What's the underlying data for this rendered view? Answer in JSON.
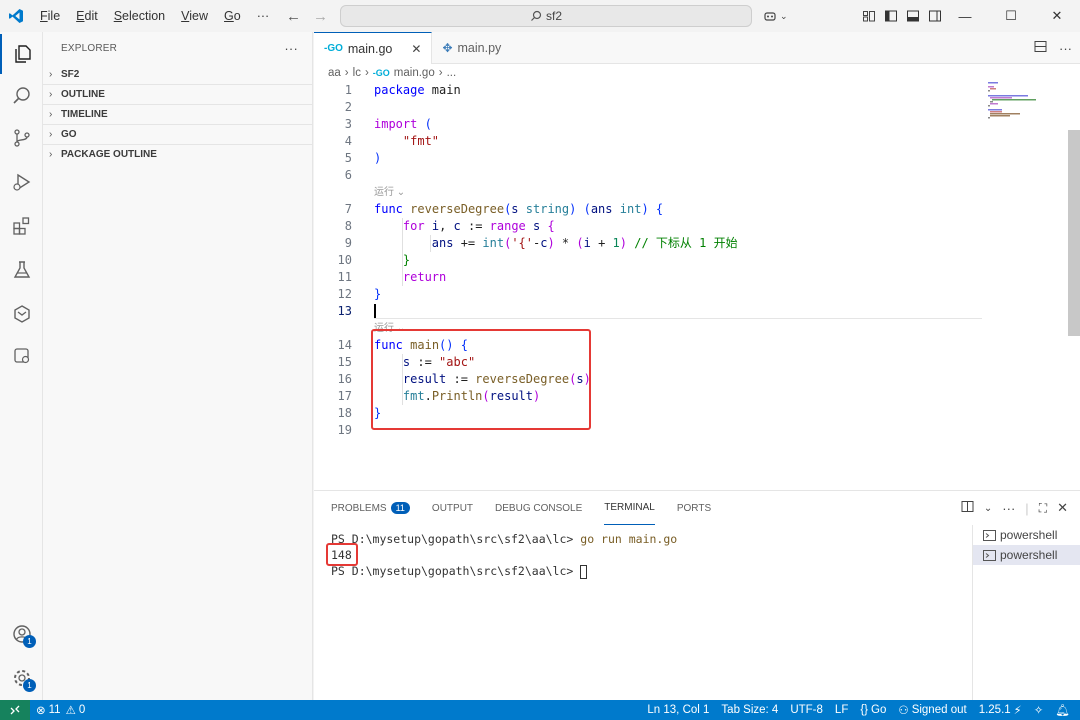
{
  "menu": {
    "file": {
      "u": "F",
      "rest": "ile"
    },
    "edit": {
      "u": "E",
      "rest": "dit"
    },
    "selection": {
      "u": "S",
      "rest": "election"
    },
    "view": {
      "u": "V",
      "rest": "iew"
    },
    "go": {
      "u": "G",
      "rest": "o"
    },
    "more": "···"
  },
  "search": {
    "text": "sf2"
  },
  "explorer": {
    "title": "EXPLORER",
    "more": "···",
    "sections": [
      "SF2",
      "OUTLINE",
      "TIMELINE",
      "GO",
      "PACKAGE OUTLINE"
    ]
  },
  "tabs": [
    {
      "label": "main.go",
      "close": "✕"
    },
    {
      "label": "main.py"
    }
  ],
  "breadcrumb": {
    "folder1": "aa",
    "folder2": "lc",
    "file": "main.go",
    "more": "..."
  },
  "codelens": "运行",
  "code": {
    "lines": [
      {
        "n": "1",
        "parts": [
          [
            "kw",
            "package"
          ],
          [
            "",
            " main"
          ]
        ]
      },
      {
        "n": "2",
        "parts": []
      },
      {
        "n": "3",
        "parts": [
          [
            "kw2",
            "import"
          ],
          [
            "",
            " "
          ],
          [
            "par",
            "("
          ]
        ]
      },
      {
        "n": "4",
        "parts": [
          [
            "",
            "    "
          ],
          [
            "str",
            "\"fmt\""
          ]
        ]
      },
      {
        "n": "5",
        "parts": [
          [
            "par",
            ")"
          ]
        ]
      },
      {
        "n": "6",
        "parts": []
      },
      {
        "n": "7",
        "parts": [
          [
            "kw",
            "func"
          ],
          [
            "",
            " "
          ],
          [
            "fn",
            "reverseDegree"
          ],
          [
            "par",
            "("
          ],
          [
            "var",
            "s"
          ],
          [
            "",
            " "
          ],
          [
            "ty",
            "string"
          ],
          [
            "par",
            ")"
          ],
          [
            "",
            " "
          ],
          [
            "par",
            "("
          ],
          [
            "var",
            "ans"
          ],
          [
            "",
            " "
          ],
          [
            "ty",
            "int"
          ],
          [
            "par",
            ")"
          ],
          [
            "",
            " "
          ],
          [
            "par",
            "{"
          ]
        ]
      },
      {
        "n": "8",
        "parts": [
          [
            "",
            "    "
          ],
          [
            "kw2",
            "for"
          ],
          [
            "",
            " "
          ],
          [
            "var",
            "i"
          ],
          [
            "",
            ", "
          ],
          [
            "var",
            "c"
          ],
          [
            "",
            " := "
          ],
          [
            "kw2",
            "range"
          ],
          [
            "",
            " "
          ],
          [
            "var",
            "s"
          ],
          [
            "",
            " "
          ],
          [
            "kw2",
            "{"
          ]
        ]
      },
      {
        "n": "9",
        "parts": [
          [
            "",
            "        "
          ],
          [
            "var",
            "ans"
          ],
          [
            "",
            " += "
          ],
          [
            "ty",
            "int"
          ],
          [
            "kw2",
            "("
          ],
          [
            "str",
            "'{'"
          ],
          [
            "",
            "-"
          ],
          [
            "var",
            "c"
          ],
          [
            "kw2",
            ")"
          ],
          [
            "",
            " * "
          ],
          [
            "kw2",
            "("
          ],
          [
            "var",
            "i"
          ],
          [
            "",
            " + "
          ],
          [
            "num",
            "1"
          ],
          [
            "kw2",
            ")"
          ],
          [
            "",
            " "
          ],
          [
            "com",
            "// 下标从 1 开始"
          ]
        ]
      },
      {
        "n": "10",
        "parts": [
          [
            "",
            "    "
          ],
          [
            "com",
            "}"
          ]
        ]
      },
      {
        "n": "11",
        "parts": [
          [
            "",
            "    "
          ],
          [
            "kw2",
            "return"
          ]
        ]
      },
      {
        "n": "12",
        "parts": [
          [
            "par",
            "}"
          ]
        ]
      },
      {
        "n": "13",
        "parts": []
      },
      {
        "n": "14",
        "parts": [
          [
            "kw",
            "func"
          ],
          [
            "",
            " "
          ],
          [
            "fn",
            "main"
          ],
          [
            "par",
            "()"
          ],
          [
            "",
            " "
          ],
          [
            "par",
            "{"
          ]
        ]
      },
      {
        "n": "15",
        "parts": [
          [
            "",
            "    "
          ],
          [
            "var",
            "s"
          ],
          [
            "",
            " := "
          ],
          [
            "str",
            "\"abc\""
          ]
        ]
      },
      {
        "n": "16",
        "parts": [
          [
            "",
            "    "
          ],
          [
            "var",
            "result"
          ],
          [
            "",
            " := "
          ],
          [
            "fn",
            "reverseDegree"
          ],
          [
            "kw2",
            "("
          ],
          [
            "var",
            "s"
          ],
          [
            "kw2",
            ")"
          ]
        ]
      },
      {
        "n": "17",
        "parts": [
          [
            "",
            "    "
          ],
          [
            "ty",
            "fmt"
          ],
          [
            "",
            "."
          ],
          [
            "fn",
            "Println"
          ],
          [
            "kw2",
            "("
          ],
          [
            "var",
            "result"
          ],
          [
            "kw2",
            ")"
          ]
        ]
      },
      {
        "n": "18",
        "parts": [
          [
            "par",
            "}"
          ]
        ]
      },
      {
        "n": "19",
        "parts": []
      }
    ]
  },
  "panel": {
    "tabs": [
      "PROBLEMS",
      "OUTPUT",
      "DEBUG CONSOLE",
      "TERMINAL",
      "PORTS"
    ],
    "problems_count": "11",
    "terminal": {
      "line1_prompt": "PS D:\\mysetup\\gopath\\src\\sf2\\aa\\lc>",
      "line1_cmd": "go run main.go",
      "output": "148",
      "line3_prompt": "PS D:\\mysetup\\gopath\\src\\sf2\\aa\\lc>"
    },
    "terminals": [
      "powershell",
      "powershell"
    ]
  },
  "status": {
    "errors": "11",
    "warnings": "0",
    "position": "Ln 13, Col 1",
    "tab_size": "Tab Size: 4",
    "encoding": "UTF-8",
    "eol": "LF",
    "language": "Go",
    "account": "Signed out",
    "go_version": "1.25.1"
  },
  "colors": {
    "accent": "#005fb8",
    "statusbar": "#007acc",
    "highlight_box": "#e53935"
  }
}
